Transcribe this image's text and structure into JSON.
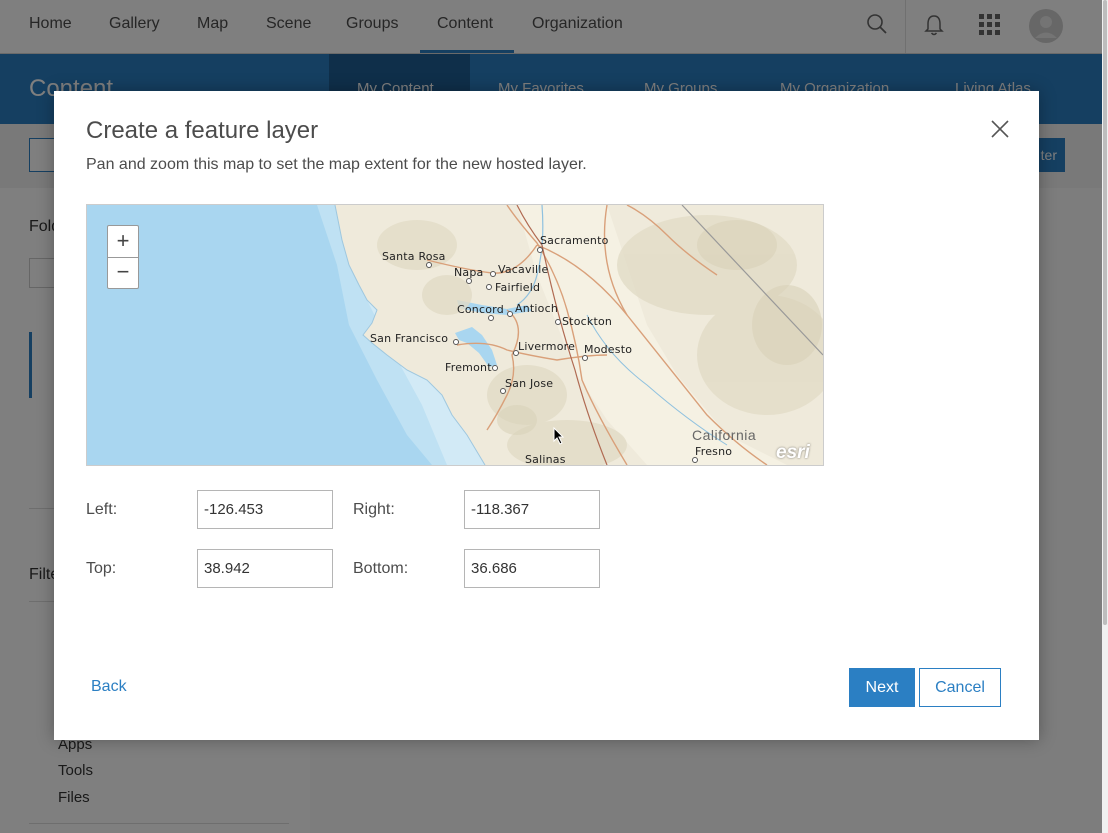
{
  "topnav": {
    "items": [
      "Home",
      "Gallery",
      "Map",
      "Scene",
      "Groups",
      "Content",
      "Organization"
    ],
    "active": "Content"
  },
  "content_header": {
    "title": "Content",
    "tabs": [
      "My Content",
      "My Favorites",
      "My Groups",
      "My Organization",
      "Living Atlas"
    ]
  },
  "sidebar": {
    "folders_label": "Fold",
    "filters_label": "Filte",
    "filter_items": [
      "Apps",
      "Tools",
      "Files"
    ]
  },
  "toolbar": {
    "right_button_fragment": "ter"
  },
  "modal": {
    "title": "Create a feature layer",
    "description": "Pan and zoom this map to set the map extent for the new hosted layer.",
    "map": {
      "zoom_in": "+",
      "zoom_out": "−",
      "state_label": "California",
      "attribution_logo": "esri",
      "cities": [
        "Sacramento",
        "Santa Rosa",
        "Napa",
        "Vacaville",
        "Fairfield",
        "Concord",
        "Antioch",
        "Stockton",
        "San Francisco",
        "Livermore",
        "Modesto",
        "Fremont",
        "San Jose",
        "Salinas",
        "Fresno"
      ]
    },
    "fields": {
      "left_label": "Left:",
      "left_value": "-126.453",
      "right_label": "Right:",
      "right_value": "-118.367",
      "top_label": "Top:",
      "top_value": "38.942",
      "bottom_label": "Bottom:",
      "bottom_value": "36.686"
    },
    "back_label": "Back",
    "next_label": "Next",
    "cancel_label": "Cancel"
  },
  "colors": {
    "accent": "#2b7fc3",
    "header": "#2b7fc3",
    "overlay": "rgba(0,0,0,0.5)"
  }
}
